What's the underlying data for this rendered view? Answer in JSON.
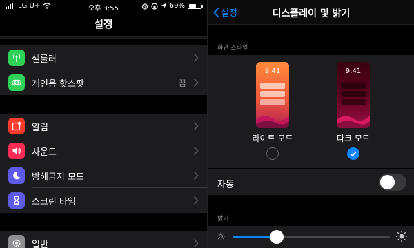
{
  "status_bar": {
    "carrier": "LG U+",
    "time": "오후 3:55",
    "battery": "69%",
    "battery_level": 0.69
  },
  "left": {
    "title": "설정",
    "group1": [
      {
        "label": "셀룰러",
        "value": "",
        "icon": "cellular-icon",
        "color": "#30d158"
      },
      {
        "label": "개인용 핫스팟",
        "value": "끔",
        "icon": "hotspot-icon",
        "color": "#30d158"
      }
    ],
    "group2": [
      {
        "label": "알림",
        "icon": "notifications-icon",
        "color": "#ff3b30"
      },
      {
        "label": "사운드",
        "icon": "sound-icon",
        "color": "#ff2d55"
      },
      {
        "label": "방해금지 모드",
        "icon": "moon-icon",
        "color": "#5e5ce6"
      },
      {
        "label": "스크린 타임",
        "icon": "hourglass-icon",
        "color": "#5e5ce6"
      }
    ],
    "group3": [
      {
        "label": "일반",
        "icon": "gear-icon",
        "color": "#8e8e93"
      }
    ]
  },
  "right": {
    "back_label": "설정",
    "title": "디스플레이 및 밝기",
    "appearance_header": "화면 스타일",
    "phone_time": "9:41",
    "light_label": "라이트 모드",
    "dark_label": "다크 모드",
    "selected_mode": "dark",
    "auto_label": "자동",
    "auto_on": false,
    "brightness_header": "밝기",
    "brightness": 0.28,
    "accent": "#0a84ff"
  }
}
